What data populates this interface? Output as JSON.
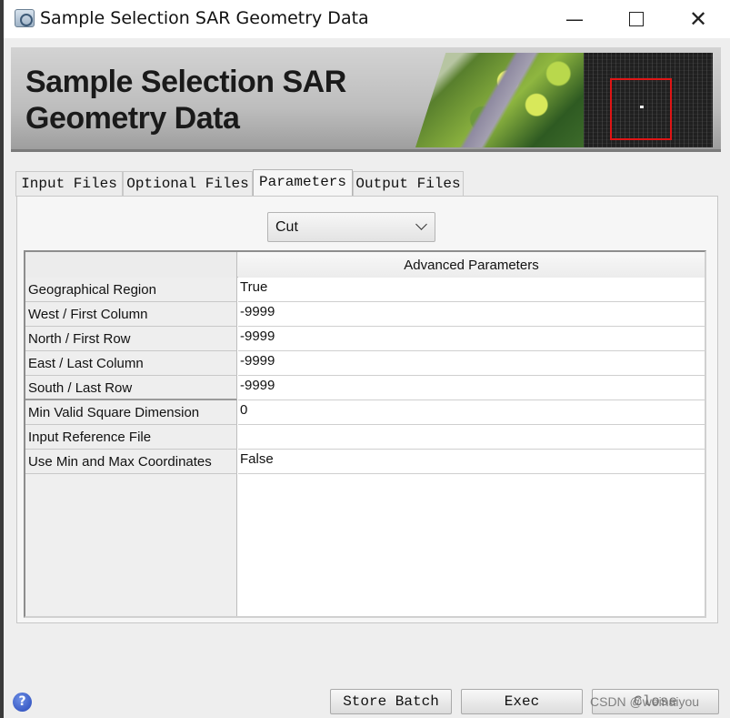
{
  "window": {
    "title": "Sample Selection SAR Geometry Data",
    "controls": {
      "minimize": "—",
      "close": "✕"
    }
  },
  "banner": {
    "title": "Sample Selection SAR\nGeometry Data"
  },
  "tabs": [
    {
      "label": "Input Files",
      "active": false
    },
    {
      "label": "Optional Files",
      "active": false
    },
    {
      "label": "Parameters",
      "active": true
    },
    {
      "label": "Output Files",
      "active": false
    }
  ],
  "parameters": {
    "mode_select": {
      "value": "Cut"
    },
    "grid": {
      "column_header": "Advanced Parameters",
      "rows": [
        {
          "label": "Geographical Region",
          "value": "True"
        },
        {
          "label": "West / First Column",
          "value": "-9999"
        },
        {
          "label": "North / First Row",
          "value": "-9999"
        },
        {
          "label": "East / Last Column",
          "value": "-9999"
        },
        {
          "label": "South / Last Row",
          "value": "-9999"
        },
        {
          "label": "Min Valid Square Dimension",
          "value": "0"
        },
        {
          "label": "Input Reference File",
          "value": ""
        },
        {
          "label": "Use Min and Max Coordinates",
          "value": "False"
        }
      ]
    }
  },
  "footer": {
    "help_icon": "?",
    "store_batch_label": "Store Batch",
    "exec_label": "Exec",
    "close_label": "Close",
    "watermark": "CSDN @weinaiyou"
  },
  "colors": {
    "banner_bg": "#c8c8c8",
    "sar_box": "#e01515",
    "help_icon": "#2f55c8"
  }
}
